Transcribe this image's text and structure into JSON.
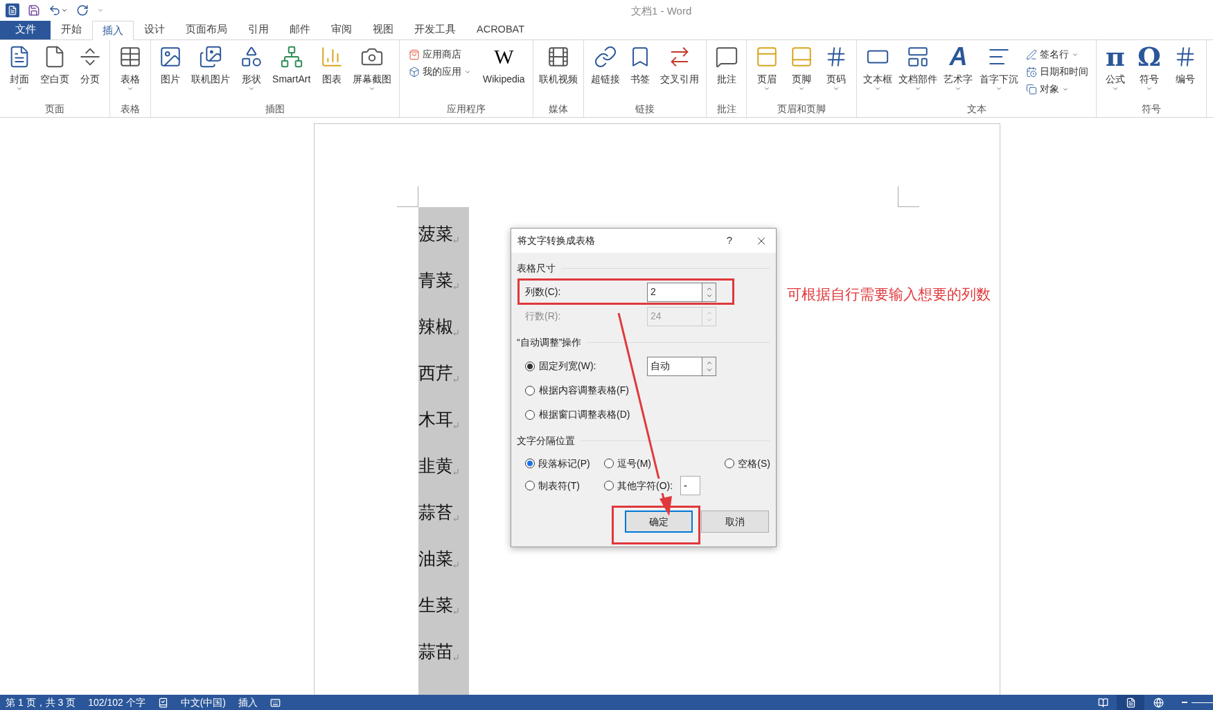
{
  "window": {
    "title": "文档1 - Word"
  },
  "tabs": [
    {
      "label": "文件",
      "kind": "file",
      "selected": false
    },
    {
      "label": "开始",
      "kind": "tab",
      "selected": false
    },
    {
      "label": "插入",
      "kind": "tab",
      "selected": true
    },
    {
      "label": "设计",
      "kind": "tab",
      "selected": false
    },
    {
      "label": "页面布局",
      "kind": "tab",
      "selected": false
    },
    {
      "label": "引用",
      "kind": "tab",
      "selected": false
    },
    {
      "label": "邮件",
      "kind": "tab",
      "selected": false
    },
    {
      "label": "审阅",
      "kind": "tab",
      "selected": false
    },
    {
      "label": "视图",
      "kind": "tab",
      "selected": false
    },
    {
      "label": "开发工具",
      "kind": "tab",
      "selected": false
    },
    {
      "label": "ACROBAT",
      "kind": "tab",
      "selected": false
    }
  ],
  "ribbon_groups": [
    {
      "label": "页面",
      "items": [
        {
          "kind": "large",
          "label": "封面",
          "dropdown": true
        },
        {
          "kind": "large",
          "label": "空白页",
          "dropdown": false
        },
        {
          "kind": "large",
          "label": "分页",
          "dropdown": false
        }
      ]
    },
    {
      "label": "表格",
      "items": [
        {
          "kind": "large",
          "label": "表格",
          "dropdown": true
        }
      ]
    },
    {
      "label": "插图",
      "items": [
        {
          "kind": "large",
          "label": "图片",
          "dropdown": false
        },
        {
          "kind": "large",
          "label": "联机图片",
          "dropdown": false
        },
        {
          "kind": "large",
          "label": "形状",
          "dropdown": true
        },
        {
          "kind": "large",
          "label": "SmartArt",
          "dropdown": false
        },
        {
          "kind": "large",
          "label": "图表",
          "dropdown": false
        },
        {
          "kind": "large",
          "label": "屏幕截图",
          "dropdown": true
        }
      ]
    },
    {
      "label": "应用程序",
      "items": [
        {
          "kind": "small",
          "label": "应用商店",
          "dropdown": false
        },
        {
          "kind": "small",
          "label": "我的应用",
          "dropdown": true
        },
        {
          "kind": "large",
          "label": "Wikipedia",
          "dropdown": false,
          "glyph": "W"
        }
      ]
    },
    {
      "label": "媒体",
      "items": [
        {
          "kind": "large",
          "label": "联机视频",
          "dropdown": false
        }
      ]
    },
    {
      "label": "链接",
      "items": [
        {
          "kind": "large",
          "label": "超链接",
          "dropdown": false
        },
        {
          "kind": "large",
          "label": "书签",
          "dropdown": false
        },
        {
          "kind": "large",
          "label": "交叉引用",
          "dropdown": false
        }
      ]
    },
    {
      "label": "批注",
      "items": [
        {
          "kind": "large",
          "label": "批注",
          "dropdown": false
        }
      ]
    },
    {
      "label": "页眉和页脚",
      "items": [
        {
          "kind": "large",
          "label": "页眉",
          "dropdown": true
        },
        {
          "kind": "large",
          "label": "页脚",
          "dropdown": true
        },
        {
          "kind": "large",
          "label": "页码",
          "dropdown": true
        }
      ]
    },
    {
      "label": "文本",
      "items": [
        {
          "kind": "large",
          "label": "文本框",
          "dropdown": true
        },
        {
          "kind": "large",
          "label": "文档部件",
          "dropdown": true
        },
        {
          "kind": "large",
          "label": "艺术字",
          "dropdown": true,
          "glyph": "A"
        },
        {
          "kind": "large",
          "label": "首字下沉",
          "dropdown": true
        },
        {
          "kind": "small",
          "label": "签名行",
          "dropdown": true
        },
        {
          "kind": "small",
          "label": "日期和时间",
          "dropdown": false
        },
        {
          "kind": "small",
          "label": "对象",
          "dropdown": true
        }
      ]
    },
    {
      "label": "符号",
      "items": [
        {
          "kind": "large",
          "label": "公式",
          "dropdown": true,
          "glyph": "π"
        },
        {
          "kind": "large",
          "label": "符号",
          "dropdown": true,
          "glyph": "Ω"
        },
        {
          "kind": "large",
          "label": "编号",
          "dropdown": false
        }
      ]
    }
  ],
  "document": {
    "lines": [
      "菠菜",
      "青菜",
      "辣椒",
      "西芹",
      "木耳",
      "韭黄",
      "蒜苔",
      "油菜",
      "生菜",
      "蒜苗"
    ]
  },
  "dialog": {
    "title": "将文字转换成表格",
    "help": "?",
    "sections": [
      {
        "kind": "size",
        "title": "表格尺寸",
        "rows": [
          {
            "label": "列数(C):",
            "value": "2",
            "disabled": false
          },
          {
            "label": "行数(R):",
            "value": "24",
            "disabled": true
          }
        ]
      },
      {
        "kind": "fit",
        "title": "“自动调整”操作",
        "options": [
          {
            "label": "固定列宽(W):",
            "selected": true,
            "value": "自动"
          },
          {
            "label": "根据内容调整表格(F)",
            "selected": false
          },
          {
            "label": "根据窗口调整表格(D)",
            "selected": false
          }
        ]
      },
      {
        "kind": "separator",
        "title": "文字分隔位置",
        "options": [
          {
            "label": "段落标记(P)",
            "selected": true
          },
          {
            "label": "逗号(M)",
            "selected": false
          },
          {
            "label": "空格(S)",
            "selected": false
          },
          {
            "label": "制表符(T)",
            "selected": false
          },
          {
            "label": "其他字符(O):",
            "selected": false,
            "value": "-"
          }
        ]
      }
    ],
    "buttons": [
      {
        "label": "确定",
        "default": true
      },
      {
        "label": "取消",
        "default": false
      }
    ]
  },
  "annotation": "可根据自行需要输入想要的列数",
  "status_bar": {
    "texts": [
      "第 1 页，共 3 页",
      "102/102 个字",
      "中文(中国)",
      "插入"
    ],
    "views": [
      {
        "selected": false
      },
      {
        "selected": true
      },
      {
        "selected": false
      }
    ]
  }
}
